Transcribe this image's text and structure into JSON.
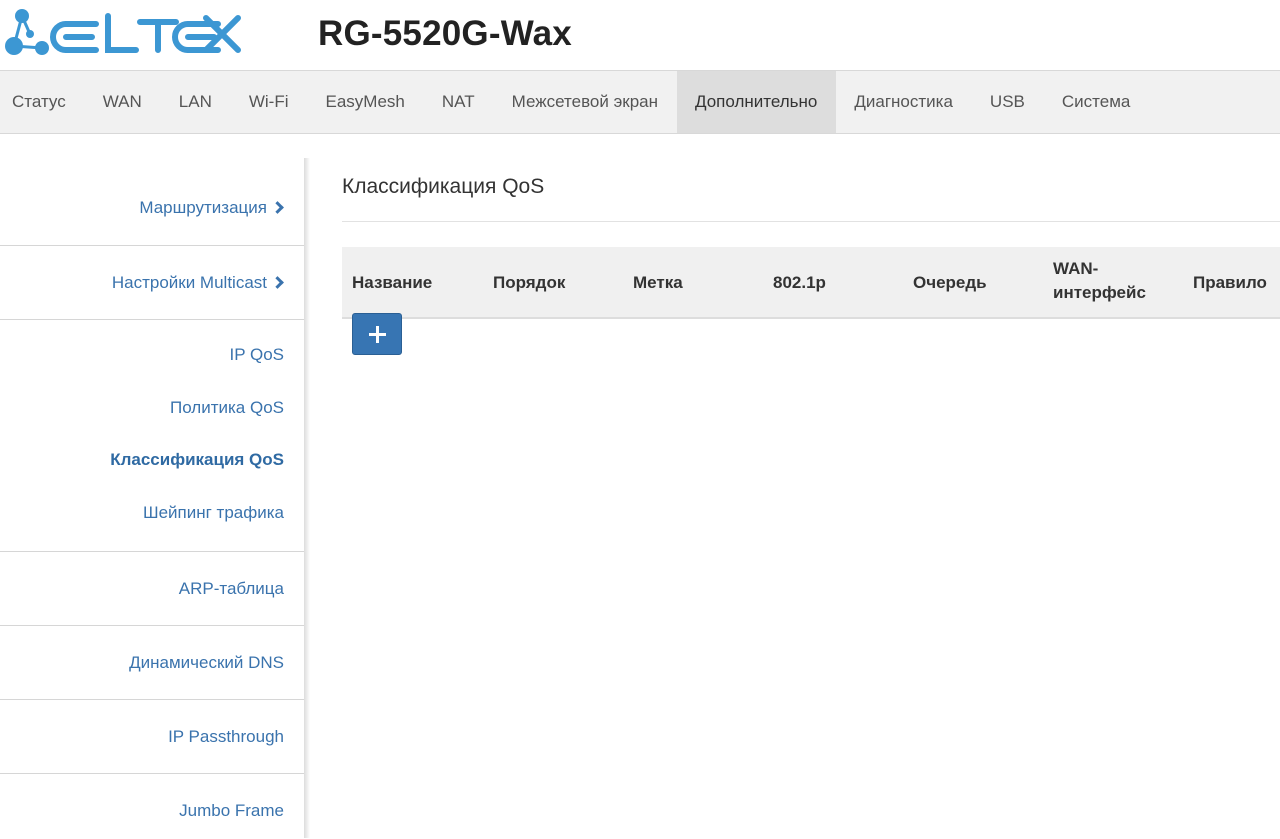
{
  "brand": {
    "logo_text": "ELTEX",
    "model": "RG-5520G-Wax",
    "logo_color": "#3c97d3"
  },
  "topnav": {
    "items": [
      {
        "label": "Статус"
      },
      {
        "label": "WAN"
      },
      {
        "label": "LAN"
      },
      {
        "label": "Wi-Fi"
      },
      {
        "label": "EasyMesh"
      },
      {
        "label": "NAT"
      },
      {
        "label": "Межсетевой экран"
      },
      {
        "label": "Дополнительно",
        "active": true
      },
      {
        "label": "Диагностика"
      },
      {
        "label": "USB"
      },
      {
        "label": "Система"
      }
    ]
  },
  "sidebar": {
    "routing": "Маршрутизация",
    "multicast": "Настройки Multicast",
    "ipqos": {
      "label": "IP QoS",
      "items": [
        "Политика QoS",
        "Классификация QoS",
        "Шейпинг трафика"
      ],
      "active_index": 1
    },
    "arp": "ARP-таблица",
    "ddns": "Динамический DNS",
    "passthrough": "IP Passthrough",
    "jumbo": "Jumbo Frame"
  },
  "main": {
    "title": "Классификация QoS",
    "table": {
      "headers": [
        "Название",
        "Порядок",
        "Метка",
        "802.1p",
        "Очередь",
        "WAN-",
        "интерфейс",
        "Правило"
      ]
    },
    "add_button_icon": "plus-icon"
  },
  "colors": {
    "link": "#3a73ad",
    "button": "#3775b3",
    "nav_bg": "#f1f1f1",
    "nav_active": "#dddddd"
  }
}
